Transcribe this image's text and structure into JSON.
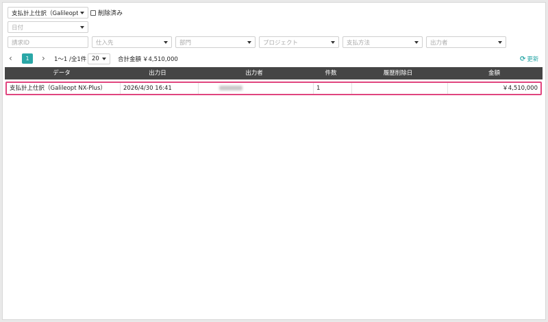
{
  "filters": {
    "report_type": "支払計上仕訳（Galileopt NX-Plus）",
    "show_deleted_label": "削除済み",
    "date_placeholder": "日付",
    "invoice_id_placeholder": "請求ID",
    "supplier_placeholder": "仕入先",
    "department_placeholder": "部門",
    "project_placeholder": "プロジェクト",
    "payment_method_placeholder": "支払方法",
    "output_by_placeholder": "出力者"
  },
  "pager": {
    "prev": "‹",
    "current_page": "1",
    "next": "›",
    "range": "1〜1 /全1件",
    "page_size": "20",
    "total_label": "合計金額",
    "total_value": "￥4,510,000",
    "refresh_label": "更新",
    "refresh_icon": "refresh-icon"
  },
  "table": {
    "columns": [
      "データ",
      "出力日",
      "出力者",
      "件数",
      "履歴削除日",
      "金額"
    ],
    "rows": [
      {
        "data": "支払計上仕訳（Galileopt NX-Plus）",
        "output_date": "2026/4/30 16:41",
        "count": "1",
        "history_deleted_date": "",
        "amount": "￥4,510,000"
      }
    ]
  },
  "colors": {
    "accent": "#2aa7a7",
    "header_bg": "#454545",
    "selected_row_border": "#e0447e"
  }
}
